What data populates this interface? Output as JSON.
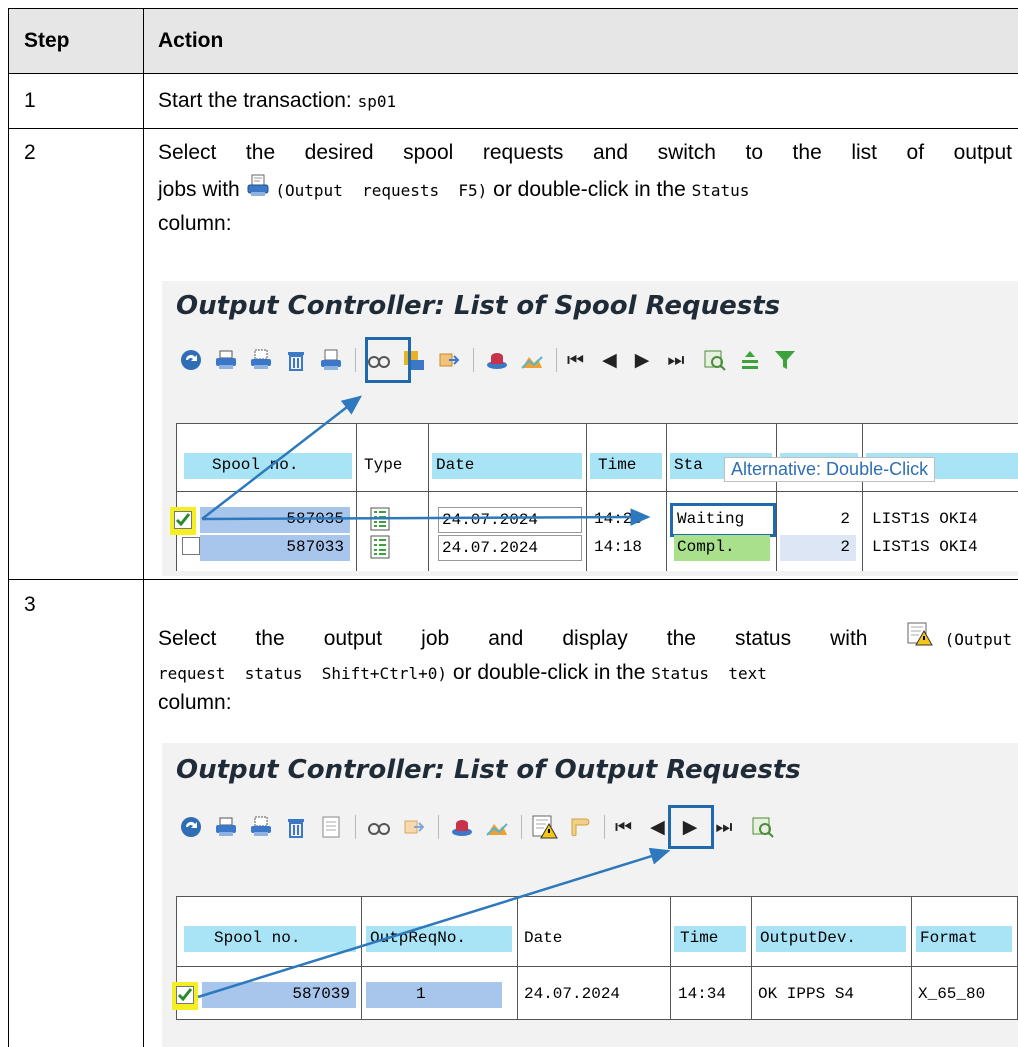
{
  "table": {
    "headers": {
      "step": "Step",
      "action": "Action"
    },
    "rows": [
      {
        "step": "1",
        "text": "Start the transaction: ",
        "code": "sp01"
      },
      {
        "step": "2",
        "line1": "Select the desired spool requests and switch to the list of output",
        "line2_a": "jobs with ",
        "line2_code1": "(Output  requests  F5)",
        "line2_b": " or double-click in the ",
        "line2_code2": "Status",
        "line3": "column:"
      },
      {
        "step": "3",
        "line1_a": "Select the output job and display the status with ",
        "line1_code": "(Output",
        "line2_code1": "request  status  Shift+Ctrl+0)",
        "line2_b": " or double-click in the ",
        "line2_code2": "Status  text",
        "line3": "column:"
      }
    ]
  },
  "screenshot1": {
    "title": "Output Controller: List of Spool Requests",
    "columns": [
      "Spool no.",
      "Type",
      "Date",
      "Time",
      "Sta",
      "",
      ""
    ],
    "tooltip": "Alternative: Double-Click",
    "rows": [
      {
        "spool": "587035",
        "date": "24.07.2024",
        "time": "14:23",
        "status": "Waiting",
        "pages": "2",
        "title": "LIST1S OKI4",
        "checked": true
      },
      {
        "spool": "587033",
        "date": "24.07.2024",
        "time": "14:18",
        "status": "Compl.",
        "pages": "2",
        "title": "LIST1S OKI4",
        "checked": false
      }
    ],
    "colors": {
      "header": "#a8e4f6",
      "spool_cell": "#a8c5ec",
      "waiting": "#ffffff",
      "completed": "#a8e08c",
      "highlight": "#2169ad",
      "checkbox_highlight": "#f4ee23"
    }
  },
  "screenshot2": {
    "title": "Output Controller: List of Output Requests",
    "columns": [
      "Spool no.",
      "OutpReqNo.",
      "Date",
      "Time",
      "OutputDev.",
      "Format"
    ],
    "rows": [
      {
        "spool": "587039",
        "outp_req": "1",
        "date": "24.07.2024",
        "time": "14:34",
        "device": "OK IPPS S4",
        "format": "X_65_80",
        "checked": true
      }
    ]
  }
}
